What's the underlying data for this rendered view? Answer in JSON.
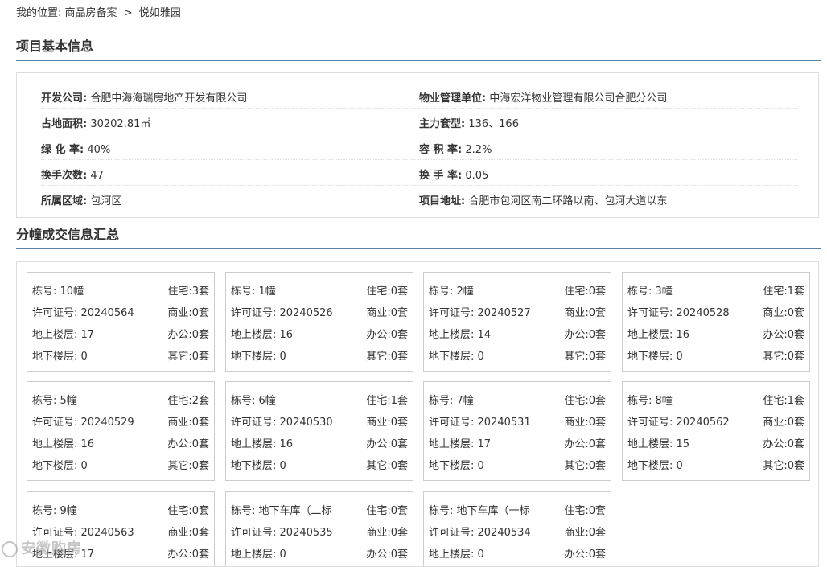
{
  "breadcrumb": {
    "prefix": "我的位置:",
    "items": [
      "商品房备案",
      "悦如雅园"
    ],
    "separator": ">"
  },
  "section_project": {
    "title": "项目基本信息",
    "rows": [
      [
        {
          "label": "开发公司:",
          "value": "合肥中海海瑞房地产开发有限公司"
        },
        {
          "label": "物业管理单位:",
          "value": "中海宏洋物业管理有限公司合肥分公司"
        }
      ],
      [
        {
          "label": "占地面积:",
          "value": "30202.81㎡"
        },
        {
          "label": "主力套型:",
          "value": "136、166"
        }
      ],
      [
        {
          "label": "绿 化 率:",
          "value": "40%"
        },
        {
          "label": "容 积 率:",
          "value": "2.2%"
        }
      ],
      [
        {
          "label": "换手次数:",
          "value": "47"
        },
        {
          "label": "换 手 率:",
          "value": "0.05"
        }
      ],
      [
        {
          "label": "所属区域:",
          "value": "包河区"
        },
        {
          "label": "项目地址:",
          "value": "合肥市包河区南二环路以南、包河大道以东"
        }
      ]
    ]
  },
  "section_buildings": {
    "title": "分幢成交信息汇总",
    "labels": {
      "building": "栋号:",
      "permit": "许可证号:",
      "above": "地上楼层:",
      "below": "地下楼层:",
      "residential": "住宅:",
      "commercial": "商业:",
      "office": "办公:",
      "other": "其它:"
    },
    "cards": [
      {
        "building": "10幢",
        "permit": "20240564",
        "above": "17",
        "below": "0",
        "residential": "3套",
        "commercial": "0套",
        "office": "0套",
        "other": "0套"
      },
      {
        "building": "1幢",
        "permit": "20240526",
        "above": "16",
        "below": "0",
        "residential": "0套",
        "commercial": "0套",
        "office": "0套",
        "other": "0套"
      },
      {
        "building": "2幢",
        "permit": "20240527",
        "above": "14",
        "below": "0",
        "residential": "0套",
        "commercial": "0套",
        "office": "0套",
        "other": "0套"
      },
      {
        "building": "3幢",
        "permit": "20240528",
        "above": "16",
        "below": "0",
        "residential": "1套",
        "commercial": "0套",
        "office": "0套",
        "other": "0套"
      },
      {
        "building": "5幢",
        "permit": "20240529",
        "above": "16",
        "below": "0",
        "residential": "2套",
        "commercial": "0套",
        "office": "0套",
        "other": "0套"
      },
      {
        "building": "6幢",
        "permit": "20240530",
        "above": "16",
        "below": "0",
        "residential": "1套",
        "commercial": "0套",
        "office": "0套",
        "other": "0套"
      },
      {
        "building": "7幢",
        "permit": "20240531",
        "above": "17",
        "below": "0",
        "residential": "0套",
        "commercial": "0套",
        "office": "0套",
        "other": "0套"
      },
      {
        "building": "8幢",
        "permit": "20240562",
        "above": "15",
        "below": "0",
        "residential": "1套",
        "commercial": "0套",
        "office": "0套",
        "other": "0套"
      },
      {
        "building": "9幢",
        "permit": "20240563",
        "above": "17",
        "below": "",
        "residential": "0套",
        "commercial": "0套",
        "office": "0套",
        "other": ""
      },
      {
        "building": "地下车库（二标",
        "permit": "20240535",
        "above": "0",
        "below": "",
        "residential": "0套",
        "commercial": "0套",
        "office": "0套",
        "other": ""
      },
      {
        "building": "地下车库（一标",
        "permit": "20240534",
        "above": "0",
        "below": "",
        "residential": "0套",
        "commercial": "0套",
        "office": "0套",
        "other": ""
      }
    ]
  },
  "watermark": {
    "text": "安徽购房",
    "icon": "watermark-logo-icon"
  }
}
